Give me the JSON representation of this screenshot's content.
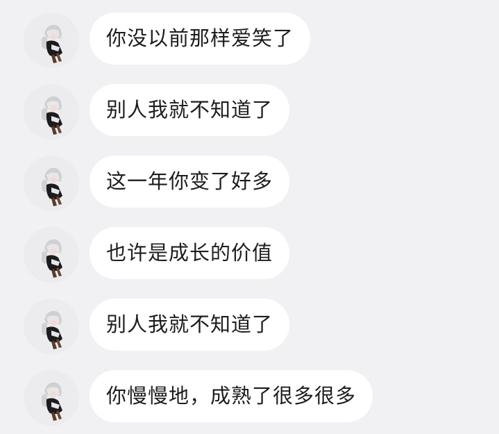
{
  "messages": [
    {
      "text": "你没以前那样爱笑了"
    },
    {
      "text": "别人我就不知道了"
    },
    {
      "text": "这一年你变了好多"
    },
    {
      "text": "也许是成长的价值"
    },
    {
      "text": "别人我就不知道了"
    },
    {
      "text": "你慢慢地，成熟了很多很多"
    }
  ],
  "colors": {
    "background": "#f1f1f3",
    "bubble": "#ffffff",
    "text": "#1d1d1d"
  }
}
